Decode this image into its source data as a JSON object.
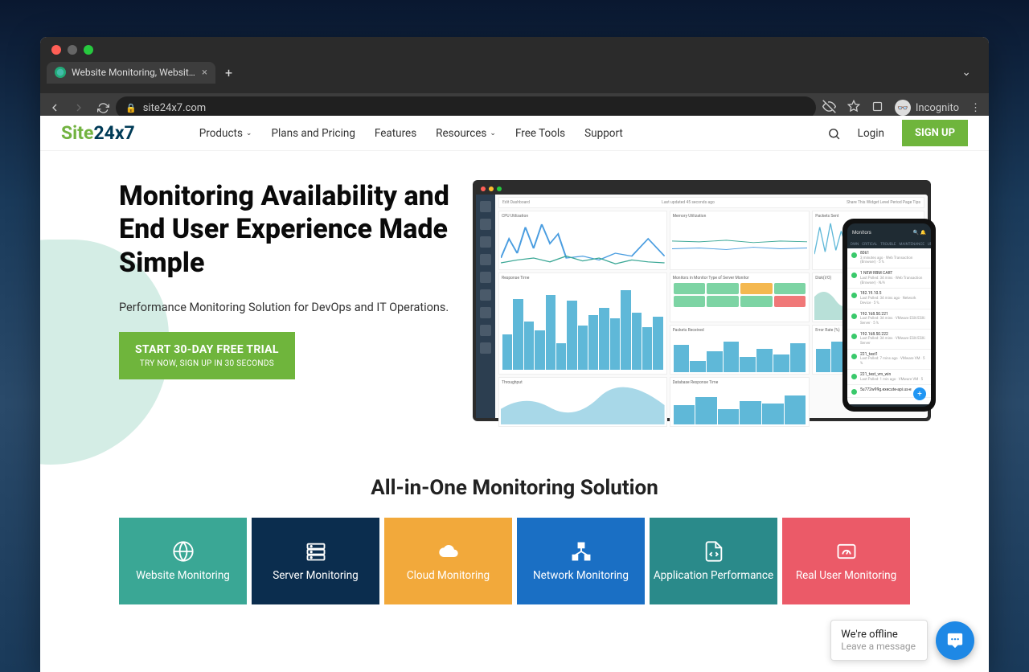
{
  "browser": {
    "tab_title": "Website Monitoring, Website M",
    "url": "site24x7.com",
    "incognito_label": "Incognito"
  },
  "nav": {
    "logo_part1": "Site",
    "logo_part2": "24x7",
    "items": [
      "Products",
      "Plans and Pricing",
      "Features",
      "Resources",
      "Free Tools",
      "Support"
    ],
    "login": "Login",
    "signup": "SIGN UP"
  },
  "hero": {
    "title": "Monitoring Availability and End User Experience Made Simple",
    "subtitle": "Performance Monitoring Solution for DevOps and IT Operations.",
    "cta_main": "START 30-DAY FREE TRIAL",
    "cta_sub": "TRY NOW, SIGN UP IN 30 SECONDS"
  },
  "dashboard": {
    "toolbar_left": "Edit Dashboard",
    "toolbar_mid": "Last updated 45 seconds ago",
    "toolbar_right": "Share This    Widget Level Period    Page Tips",
    "panels": {
      "cpu": "CPU Utilization",
      "memory": "Memory Utilization",
      "packets_sent": "Packets Sent",
      "monitor_type": "Monitors in Monitor Type of Server Monitor",
      "disk_io": "Disk(I/O)",
      "response_time": "Response Time",
      "packets_received": "Packets Received",
      "error_rate": "Error Rate (%)",
      "throughput": "Throughput",
      "db_response": "Database Response Time"
    }
  },
  "phone": {
    "header": "Monitors",
    "tabs": [
      "DWN",
      "CRITICAL",
      "TROUBLE",
      "MAINTENANCE",
      "UP"
    ],
    "rows": [
      {
        "t": "8061",
        "s": "3 minutes ago · Web Transaction (Browser) · 5 %"
      },
      {
        "t": "1 NEW RBM CART",
        "s": "Last Polled: 34 mins · Web Transaction (Browser) · N/A"
      },
      {
        "t": "182.19.10.5",
        "s": "Last Polled: 34 mins ago · Network Device · 5 %"
      },
      {
        "t": "192.168.50.221",
        "s": "Last Polled: 34 mins · VMware ESX/ESXi Server · 5 %"
      },
      {
        "t": "192.168.50.222",
        "s": "Last Polled: 34 mins · VMware ESX/ESXi Server"
      },
      {
        "t": "221_test1",
        "s": "Last Polled: 7 mins ago · VMware VM · 5 %"
      },
      {
        "t": "221_test_vm_win",
        "s": "Last Polled: 1 min ago · VMware VM · 5"
      },
      {
        "t": "5u772w99g.execute-api.us-e",
        "s": ""
      }
    ]
  },
  "solutions": {
    "title": "All-in-One Monitoring Solution",
    "cards": [
      {
        "label": "Website Monitoring"
      },
      {
        "label": "Server Monitoring"
      },
      {
        "label": "Cloud Monitoring"
      },
      {
        "label": "Network Monitoring"
      },
      {
        "label": "Application Performance"
      },
      {
        "label": "Real User Monitoring"
      }
    ]
  },
  "chat": {
    "line1": "We're offline",
    "line2": "Leave a message"
  }
}
